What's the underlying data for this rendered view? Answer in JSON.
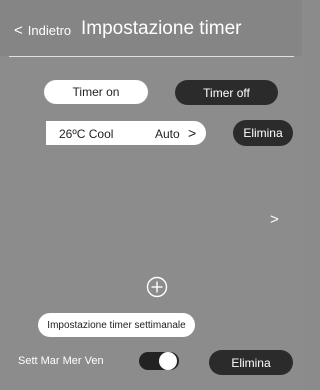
{
  "header": {
    "back_label": "Indietro",
    "title": "Impostazione timer"
  },
  "tabs": {
    "timer_on": "Timer on",
    "timer_off": "Timer off",
    "active": "timer_off"
  },
  "setting": {
    "value": "26ºC Cool",
    "mode": "Auto"
  },
  "actions": {
    "delete_top": "Elimina",
    "delete_bottom": "Elimina",
    "weekly_button": "Impostazione timer settimanale"
  },
  "schedule": {
    "days": "Sett Mar Mer Ven",
    "enabled": true
  },
  "colors": {
    "background": "#8c8c8c",
    "header": "#858585",
    "dark_pill": "#2b2b2b",
    "light_pill": "#ffffff"
  },
  "icons": {
    "back": "chevron-left-icon",
    "setting_arrow": "chevron-right-icon",
    "row_arrow": "chevron-right-icon",
    "add": "plus-circle-icon"
  }
}
